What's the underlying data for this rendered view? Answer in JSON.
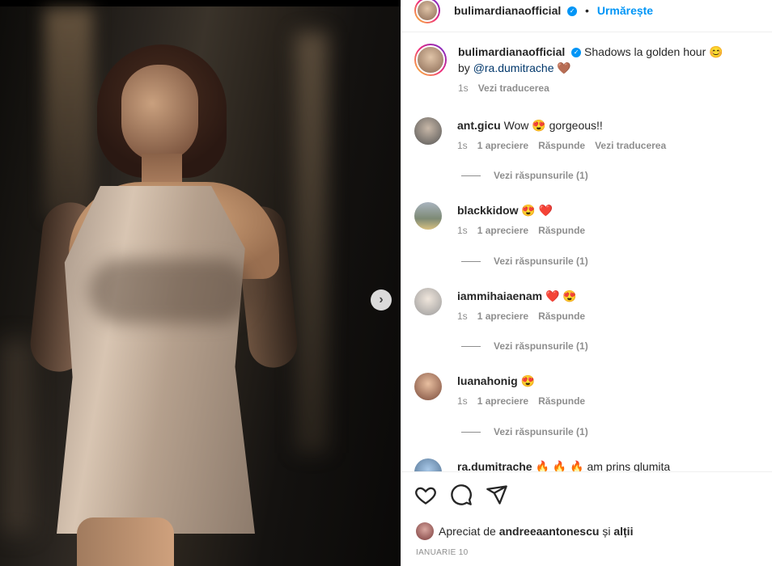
{
  "post": {
    "author": "bulimardianaofficial",
    "follow_label": "Urmărește",
    "separator": "•",
    "caption_text": "Shadows la golden hour 😊",
    "caption_by": "by",
    "caption_mention": "@ra.dumitrache",
    "caption_emoji": "🤎",
    "caption_time": "1s",
    "caption_translate": "Vezi traducerea",
    "next_glyph": "›"
  },
  "comments": [
    {
      "user": "ant.gicu",
      "text": "Wow 😍 gorgeous!!",
      "time": "1s",
      "likes": "1 apreciere",
      "reply": "Răspunde",
      "translate": "Vezi traducerea",
      "replies": "Vezi răspunsurile (1)"
    },
    {
      "user": "blackkidow",
      "text": "😍 ❤️",
      "time": "1s",
      "likes": "1 apreciere",
      "reply": "Răspunde",
      "replies": "Vezi răspunsurile (1)"
    },
    {
      "user": "iammihaiaenam",
      "text": "❤️ 😍",
      "time": "1s",
      "likes": "1 apreciere",
      "reply": "Răspunde",
      "replies": "Vezi răspunsurile (1)"
    },
    {
      "user": "luanahonig",
      "text": "😍",
      "time": "1s",
      "likes": "1 apreciere",
      "reply": "Răspunde",
      "replies": "Vezi răspunsurile (1)"
    },
    {
      "user": "ra.dumitrache",
      "text": "🔥 🔥 🔥 am prins glumita"
    }
  ],
  "footer": {
    "liked_prefix": "Apreciat de",
    "liked_user": "andreeaantonescu",
    "liked_and": "și",
    "liked_others": "alții",
    "date": "IANUARIE 10"
  },
  "colors": {
    "accent": "#0095f6",
    "muted": "#8e8e8e",
    "text": "#262626"
  }
}
